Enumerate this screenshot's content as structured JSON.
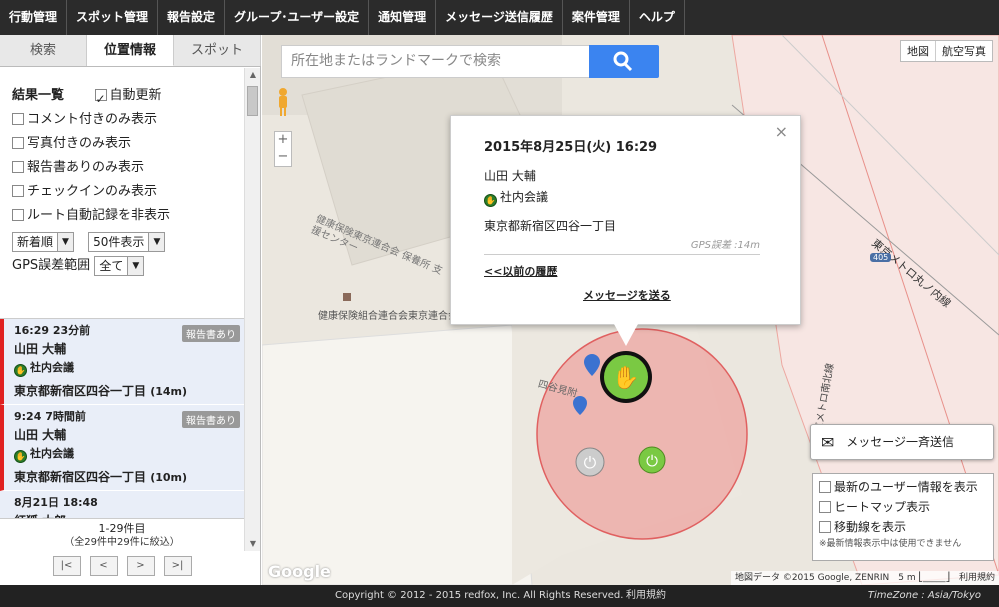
{
  "nav": {
    "items": [
      "行動管理",
      "スポット管理",
      "報告設定",
      "グループ･ユーザー設定",
      "通知管理",
      "メッセージ送信履歴",
      "案件管理",
      "ヘルプ"
    ]
  },
  "sidebar": {
    "tabs": [
      "検索",
      "位置情報",
      "スポット"
    ],
    "active_tab": "位置情報",
    "results_label": "結果一覧",
    "auto_update": {
      "label": "自動更新",
      "checked": true
    },
    "filters": [
      {
        "label": "コメント付きのみ表示",
        "checked": false
      },
      {
        "label": "写真付きのみ表示",
        "checked": false
      },
      {
        "label": "報告書ありのみ表示",
        "checked": false
      },
      {
        "label": "チェックインのみ表示",
        "checked": false
      },
      {
        "label": "ルート自動記録を非表示",
        "checked": false
      }
    ],
    "sort_select": "新着順",
    "count_select": "50件表示",
    "gps_label": "GPS誤差範囲",
    "gps_select": "全て",
    "results": [
      {
        "time": "16:29 23分前",
        "badge": "報告書あり",
        "name": "山田 大輔",
        "category": "社内会議",
        "address": "東京都新宿区四谷一丁目",
        "accuracy": "(14m)"
      },
      {
        "time": "9:24 7時間前",
        "badge": "報告書あり",
        "name": "山田 大輔",
        "category": "社内会議",
        "address": "東京都新宿区四谷一丁目",
        "accuracy": "(10m)"
      },
      {
        "time": "8月21日 18:48",
        "badge": "",
        "name": "紅狐 太郎",
        "category": "",
        "address": "",
        "accuracy": ""
      }
    ],
    "pager": {
      "range": "1-29件目",
      "summary": "（全29件中29件に絞込）",
      "buttons": [
        "|<",
        "<",
        ">",
        ">|"
      ]
    }
  },
  "map": {
    "search_placeholder": "所在地またはランドマークで検索",
    "type_buttons": [
      "地図",
      "航空写真"
    ],
    "zoom_in": "+",
    "zoom_out": "−",
    "labels": {
      "building": "健康保険組合連合会東京連合会",
      "building_alt": "健康保険東京連合会 保養所 支援センター",
      "area": "四谷見附",
      "subway": "東京メトロ丸ノ内線",
      "road1": "東京メトロ南北線",
      "route": "405"
    },
    "popup": {
      "datetime": "2015年8月25日(火) 16:29",
      "name": "山田 大輔",
      "category": "社内会議",
      "address": "東京都新宿区四谷一丁目",
      "gps": "GPS誤差 :14m",
      "prev_link": "<<以前の履歴",
      "message_link": "メッセージを送る",
      "close": "×"
    },
    "bulk_message": "メッセージ一斉送信",
    "options": [
      {
        "label": "最新のユーザー情報を表示",
        "checked": false
      },
      {
        "label": "ヒートマップ表示",
        "checked": false
      },
      {
        "label": "移動線を表示",
        "checked": false
      }
    ],
    "options_note": "※最新情報表示中は使用できません",
    "attribution": "地図データ ©2015 Google, ZENRIN　5 m ⎣_____⎦　利用規約",
    "google": "Google"
  },
  "footer": {
    "copyright": "Copyright © 2012 - 2015 redfox, Inc. All Rights Reserved.",
    "terms": "利用規約",
    "timezone": "TimeZone : Asia/Tokyo"
  },
  "colors": {
    "nav_bg": "#2b2b2b",
    "accent_blue": "#3b84f0",
    "result_mark": "#e02020",
    "marker_green": "#7ac943",
    "circle": "#f08080"
  }
}
